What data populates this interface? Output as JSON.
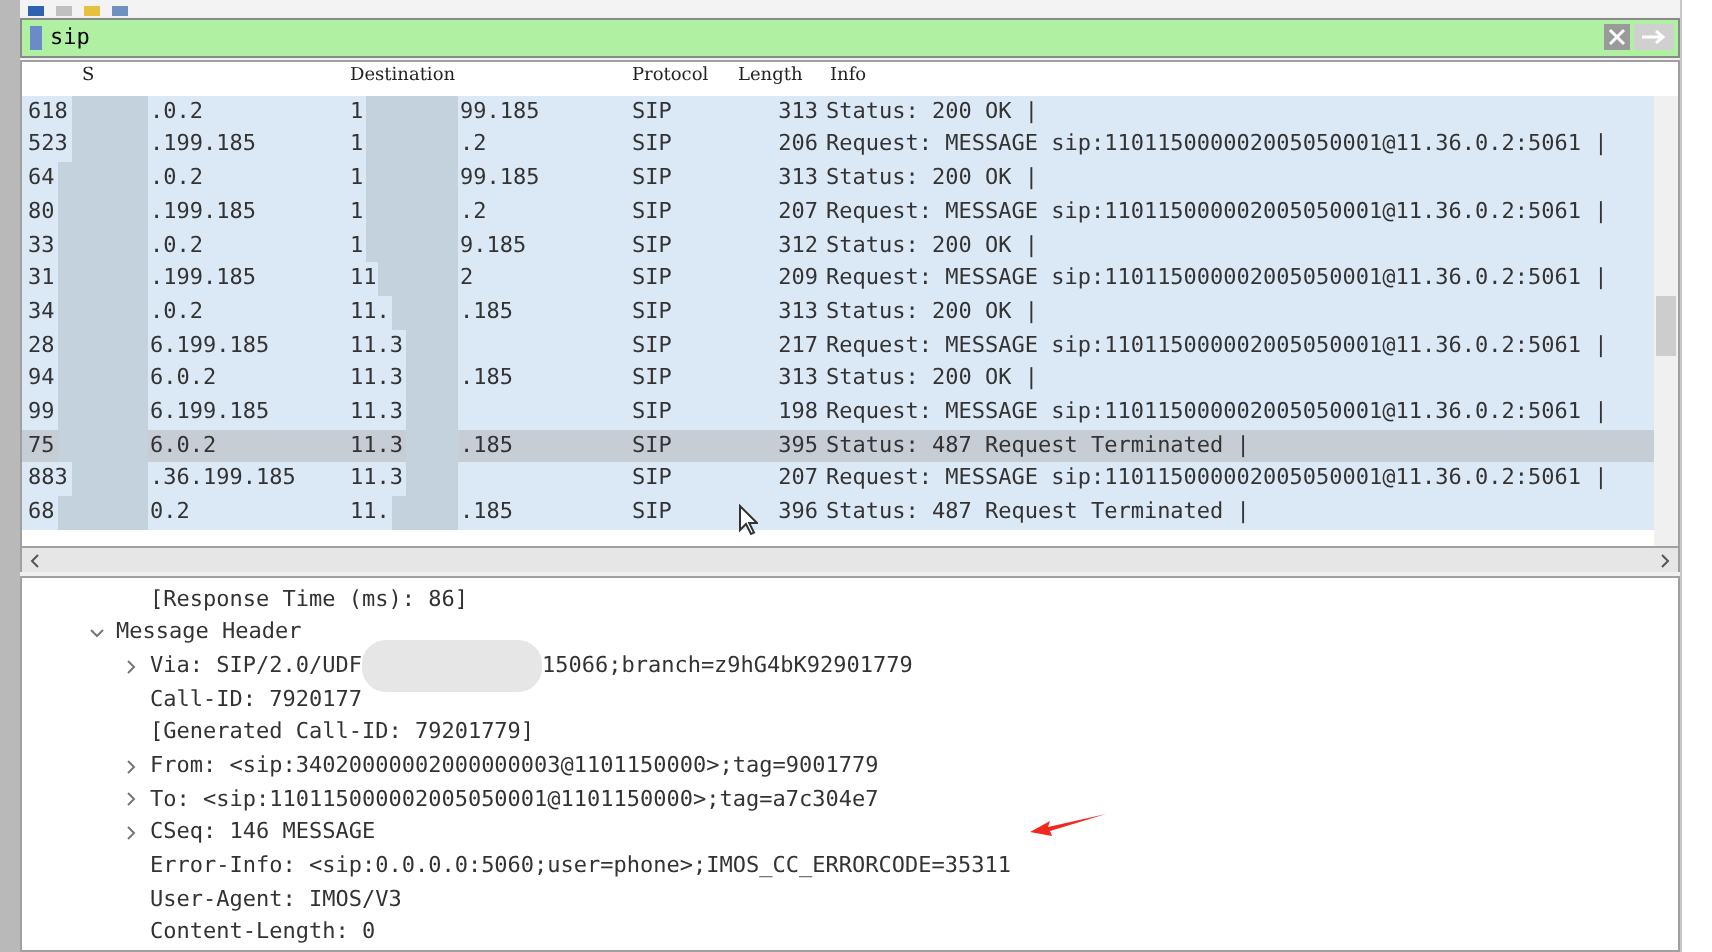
{
  "filter": {
    "value": "sip"
  },
  "packet_list": {
    "columns": [
      "S",
      "Destination",
      "Protocol",
      "Length",
      "Info"
    ],
    "rows": [
      {
        "column_1": "618",
        "source": ".0.2",
        "destination_start": "1",
        "destination_end": "99.185",
        "protocol": "SIP",
        "length": "313",
        "info": "Status: 200 OK |",
        "selected": false
      },
      {
        "column_1": "523",
        "source": ".199.185",
        "destination_start": "1",
        "destination_end": ".2",
        "protocol": "SIP",
        "length": "206",
        "info": "Request: MESSAGE sip:110115000002005050001@11.36.0.2:5061 |",
        "selected": false
      },
      {
        "column_1": "64",
        "source": ".0.2",
        "destination_start": "1",
        "destination_end": "99.185",
        "protocol": "SIP",
        "length": "313",
        "info": "Status: 200 OK |",
        "selected": false
      },
      {
        "column_1": "80",
        "source": ".199.185",
        "destination_start": "1",
        "destination_end": ".2",
        "protocol": "SIP",
        "length": "207",
        "info": "Request: MESSAGE sip:110115000002005050001@11.36.0.2:5061 |",
        "selected": false
      },
      {
        "column_1": "33",
        "source": ".0.2",
        "destination_start": "1",
        "destination_end": "9.185",
        "protocol": "SIP",
        "length": "312",
        "info": "Status: 200 OK |",
        "selected": false
      },
      {
        "column_1": "31",
        "source": ".199.185",
        "destination_start": "11",
        "destination_end": "2",
        "protocol": "SIP",
        "length": "209",
        "info": "Request: MESSAGE sip:110115000002005050001@11.36.0.2:5061 |",
        "selected": false
      },
      {
        "column_1": "34",
        "source": ".0.2",
        "destination_start": "11.",
        "destination_end": ".185",
        "protocol": "SIP",
        "length": "313",
        "info": "Status: 200 OK |",
        "selected": false
      },
      {
        "column_1": "28",
        "source": "6.199.185",
        "destination_start": "11.3",
        "destination_end": "",
        "protocol": "SIP",
        "length": "217",
        "info": "Request: MESSAGE sip:110115000002005050001@11.36.0.2:5061 |",
        "selected": false
      },
      {
        "column_1": "94",
        "source": "6.0.2",
        "destination_start": "11.3",
        "destination_end": ".185",
        "protocol": "SIP",
        "length": "313",
        "info": "Status: 200 OK |",
        "selected": false
      },
      {
        "column_1": "99",
        "source": "6.199.185",
        "destination_start": "11.3",
        "destination_end": "",
        "protocol": "SIP",
        "length": "198",
        "info": "Request: MESSAGE sip:110115000002005050001@11.36.0.2:5061 |",
        "selected": false
      },
      {
        "column_1": "75",
        "source": "6.0.2",
        "destination_start": "11.3",
        "destination_end": ".185",
        "protocol": "SIP",
        "length": "395",
        "info": "Status: 487 Request Terminated |",
        "selected": true
      },
      {
        "column_1": "883",
        "source": ".36.199.185",
        "destination_start": "11.3",
        "destination_end": "",
        "protocol": "SIP",
        "length": "207",
        "info": "Request: MESSAGE sip:110115000002005050001@11.36.0.2:5061 |",
        "selected": false
      },
      {
        "column_1": "68",
        "source": "0.2",
        "destination_start": "11.",
        "destination_end": ".185",
        "protocol": "SIP",
        "length": "396",
        "info": "Status: 487 Request Terminated |",
        "selected": false
      }
    ]
  },
  "details": [
    {
      "text": "[Response Time (ms): 86]",
      "expandable": false
    },
    {
      "text": "Message Header",
      "expandable": true,
      "expanded": true,
      "children": [
        {
          "text": "Via: SIP/2.0/UDF",
          "text_after": "15066;branch=z9hG4bK92901779",
          "expandable": true,
          "expanded": false
        },
        {
          "text": "Call-ID: 7920177",
          "expandable": false
        },
        {
          "text": "[Generated Call-ID: 79201779]",
          "expandable": false
        },
        {
          "text": "From: <sip:34020000002000000003@1101150000>;tag=9001779",
          "expandable": true,
          "expanded": false
        },
        {
          "text": "To: <sip:110115000002005050001@1101150000>;tag=a7c304e7",
          "expandable": true,
          "expanded": false
        },
        {
          "text": "CSeq: 146 MESSAGE",
          "expandable": true,
          "expanded": false
        },
        {
          "text": "Error-Info: <sip:0.0.0.0:5060;user=phone>;IMOS_CC_ERRORCODE=35311",
          "expandable": false
        },
        {
          "text": "User-Agent: IMOS/V3",
          "expandable": false
        },
        {
          "text": "Content-Length: 0",
          "expandable": false
        }
      ]
    }
  ]
}
